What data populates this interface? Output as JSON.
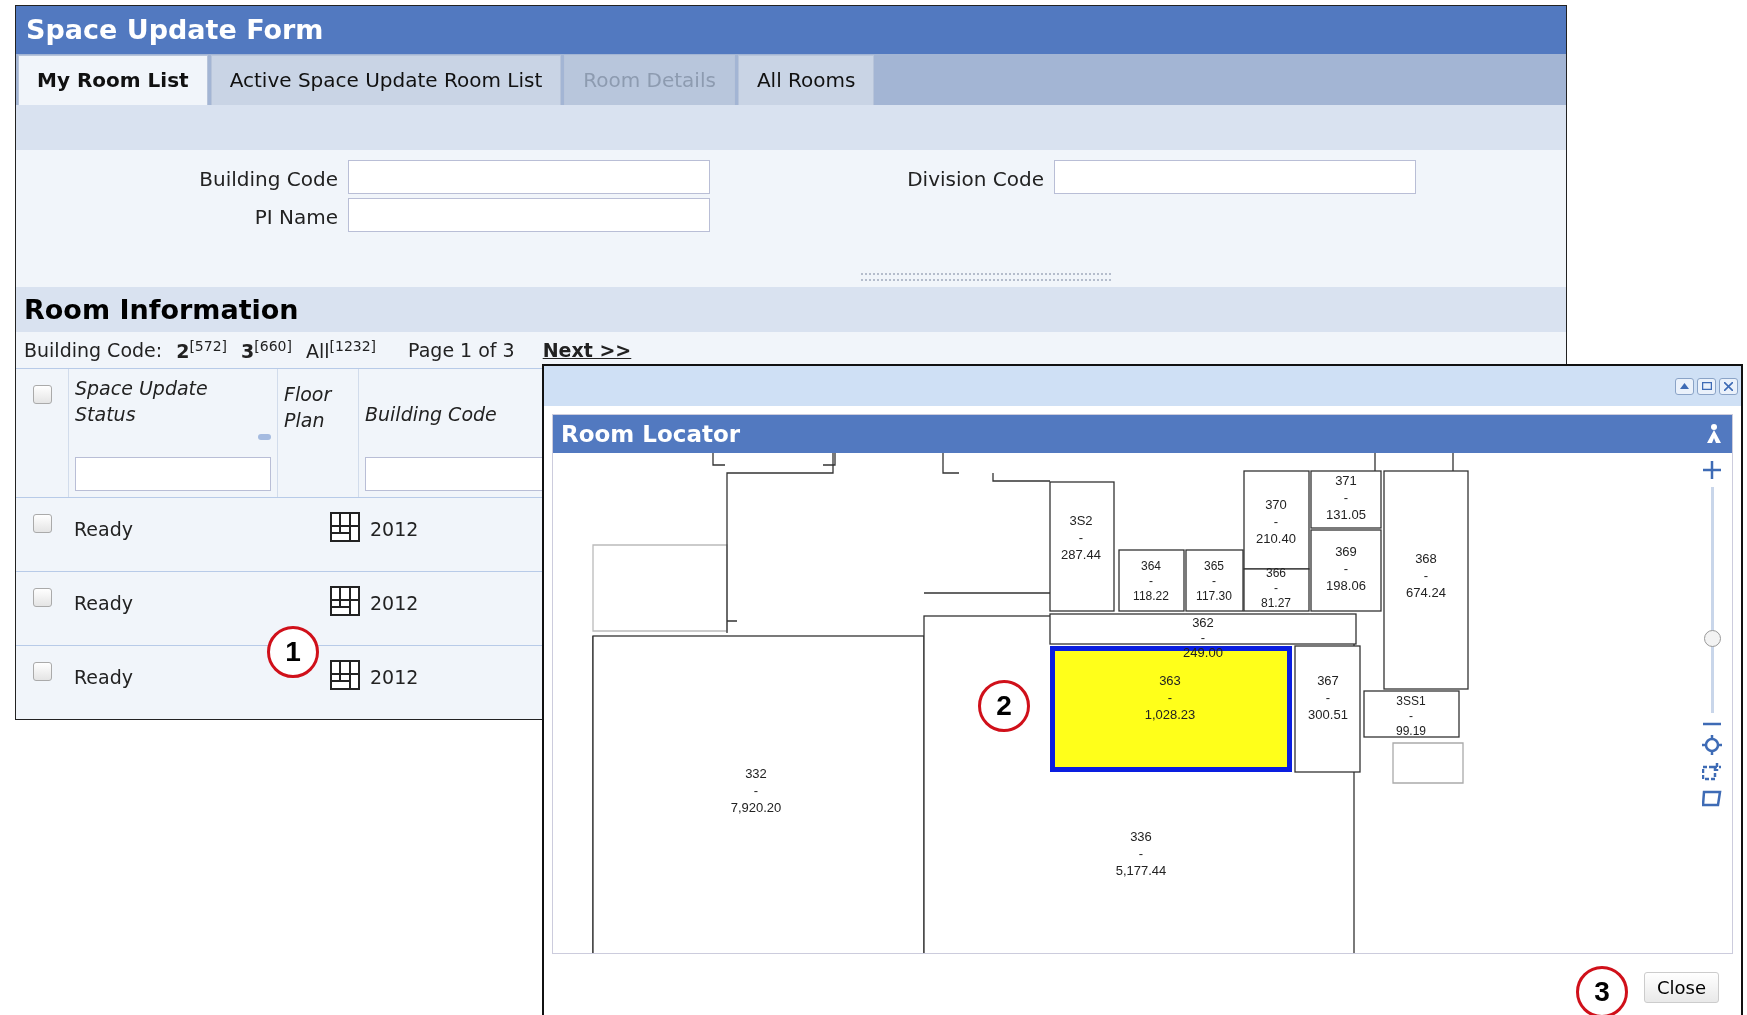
{
  "form": {
    "title": "Space Update Form",
    "tabs": [
      {
        "label": "My Room List",
        "selected": true,
        "disabled": false
      },
      {
        "label": "Active Space Update Room List",
        "selected": false,
        "disabled": false
      },
      {
        "label": "Room Details",
        "selected": false,
        "disabled": true
      },
      {
        "label": "All Rooms",
        "selected": false,
        "disabled": false
      }
    ],
    "fields": [
      {
        "label": "Building Code"
      },
      {
        "label": "Division Code"
      },
      {
        "label": "PI Name"
      }
    ],
    "section_title": "Room Information",
    "filter_label": "Building Code:",
    "filters": [
      {
        "text": "**2**$^{[572]}$"
      },
      {
        "text": "**3**$^{[660]}$"
      },
      {
        "text": "All$^{[1232]}$"
      }
    ],
    "page_info": "Page 1 of 3",
    "next_link": "Next >>",
    "table": {
      "header_checked": false,
      "columns": [
        "Space Update Status",
        "Floor Plan",
        "Building Code"
      ],
      "rows": [
        {
          "checked": false,
          "status": "Ready",
          "building_code": "2012"
        },
        {
          "checked": false,
          "status": "Ready",
          "building_code": "2012"
        },
        {
          "checked": false,
          "status": "Ready",
          "building_code": "2012"
        }
      ]
    }
  },
  "dialog": {
    "title": "Room Locator",
    "zoom": {
      "level": 0.32
    },
    "rooms": [
      {
        "label": [
          "3S2",
          "-",
          "287.44"
        ],
        "selected": false
      },
      {
        "label": [
          "364",
          "-",
          "118.22"
        ],
        "selected": false
      },
      {
        "label": [
          "365",
          "-",
          "117.30"
        ],
        "selected": false
      },
      {
        "label": [
          "370",
          "-",
          "210.40"
        ],
        "selected": false
      },
      {
        "label": [
          "366",
          "-",
          "81.27"
        ],
        "selected": false
      },
      {
        "label": [
          "371",
          "-",
          "131.05"
        ],
        "selected": false
      },
      {
        "label": [
          "369",
          "-",
          "198.06"
        ],
        "selected": false
      },
      {
        "label": [
          "368",
          "-",
          "674.24"
        ],
        "selected": false
      },
      {
        "label": [
          "362",
          "-",
          "249.00"
        ],
        "selected": false
      },
      {
        "label": [
          "363",
          "-",
          "1,028.23"
        ],
        "selected": true
      },
      {
        "label": [
          "367",
          "-",
          "300.51"
        ],
        "selected": false
      },
      {
        "label": [
          "3SS1",
          "-",
          "99.19"
        ],
        "selected": false
      },
      {
        "label": [
          "332",
          "-",
          "7,920.20"
        ],
        "selected": false
      },
      {
        "label": [
          "336",
          "-",
          "5,177.44"
        ],
        "selected": false
      }
    ],
    "close_button": "Close"
  },
  "callouts": [
    "1",
    "2",
    "3"
  ]
}
